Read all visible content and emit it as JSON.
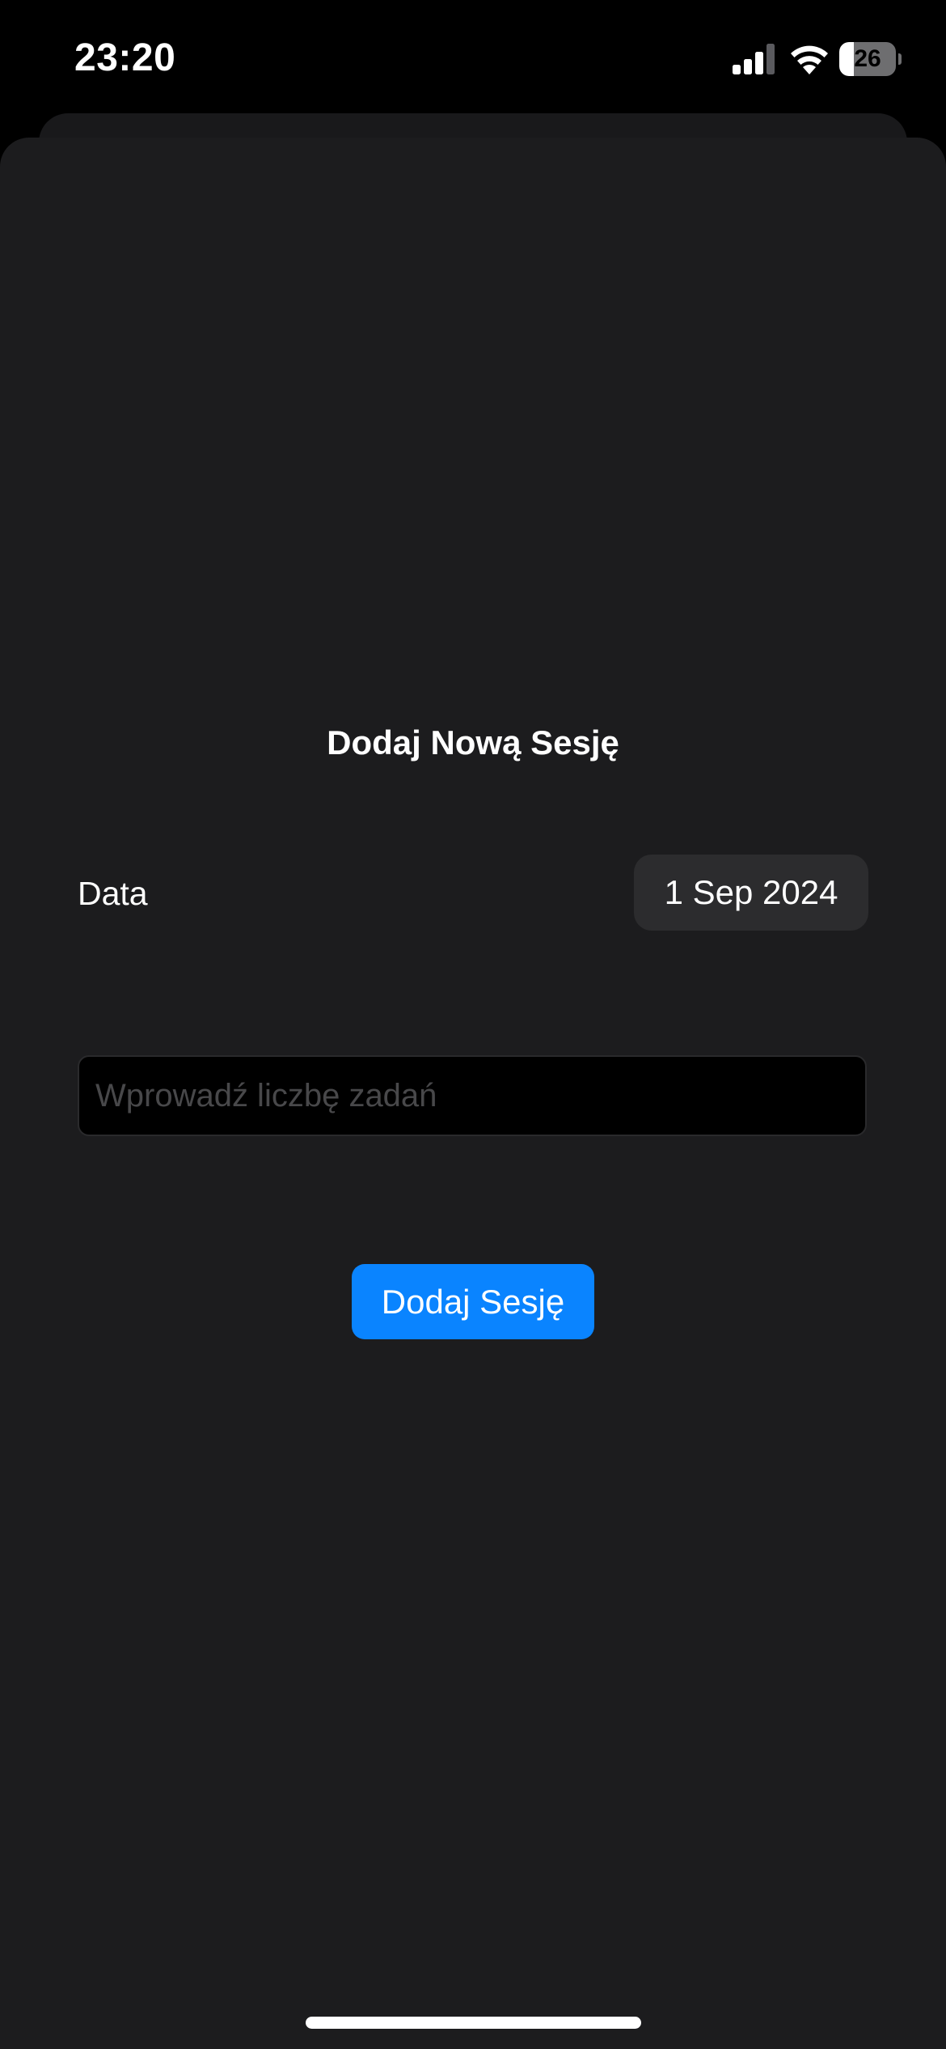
{
  "status_bar": {
    "time": "23:20",
    "battery_level": "26",
    "battery_fraction": 0.26,
    "signal_bars_active": 3,
    "signal_bars_total": 4,
    "signal_icon": "cellular-signal-icon",
    "wifi_icon": "wifi-icon",
    "battery_icon": "battery-icon"
  },
  "sheet": {
    "title": "Dodaj Nową Sesję",
    "date_label": "Data",
    "date_value": "1 Sep 2024",
    "task_input": {
      "value": "",
      "placeholder": "Wprowadź liczbę zadań"
    },
    "add_button_label": "Dodaj Sesję"
  },
  "colors": {
    "background": "#000000",
    "sheet_background": "#1c1c1e",
    "date_picker_background": "#2c2c2e",
    "accent": "#0a84ff",
    "placeholder": "#48484a",
    "text": "#ffffff"
  }
}
